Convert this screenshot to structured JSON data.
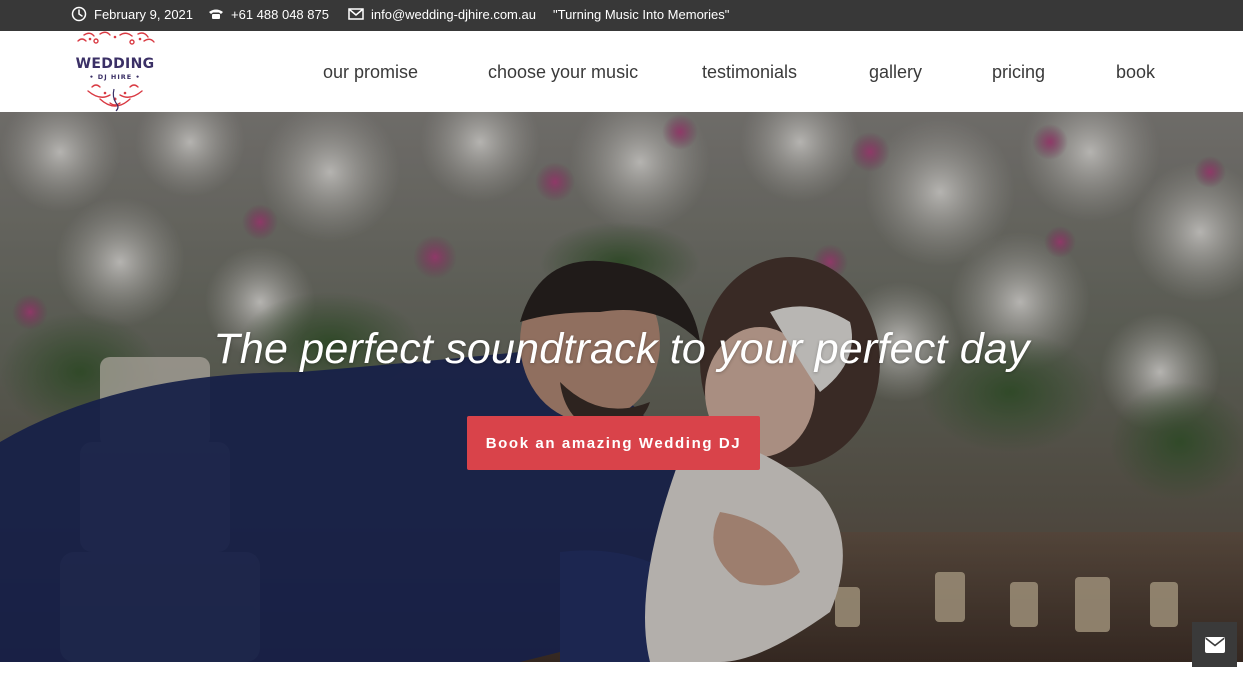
{
  "topbar": {
    "date": "February 9, 2021",
    "phone": "+61 488 048 875",
    "email": "info@wedding-djhire.com.au",
    "tagline": "\"Turning Music Into Memories\""
  },
  "logo": {
    "title": "WEDDING",
    "subtitle": "• DJ HIRE •"
  },
  "nav": {
    "items": [
      {
        "label": "our promise"
      },
      {
        "label": "choose your music"
      },
      {
        "label": "testimonials"
      },
      {
        "label": "gallery"
      },
      {
        "label": "pricing"
      },
      {
        "label": "book"
      }
    ]
  },
  "hero": {
    "title": "The perfect soundtrack to your perfect day",
    "cta_label": "Book an amazing Wedding DJ"
  },
  "colors": {
    "topbar_bg": "#383838",
    "cta_bg": "#d9434a",
    "logo_text": "#3b3066",
    "logo_accent": "#d93a43"
  },
  "icons": {
    "date": "clock-icon",
    "phone": "phone-icon",
    "email": "mail-icon",
    "contact": "envelope-icon"
  }
}
